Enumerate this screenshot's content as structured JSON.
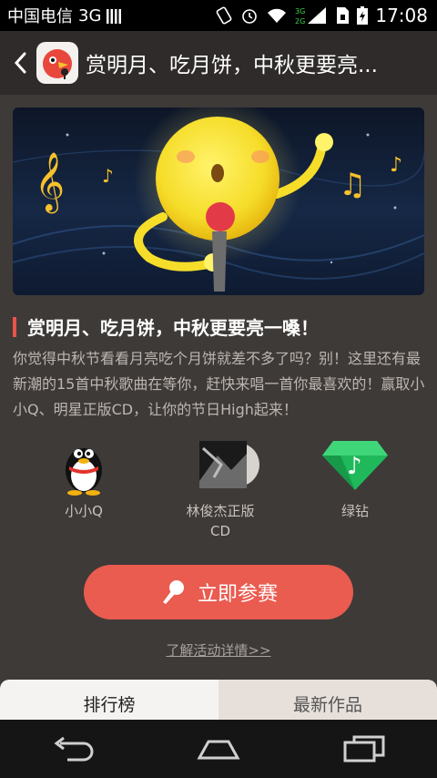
{
  "status_bar": {
    "carrier": "中国电信",
    "network": "3G",
    "time": "17:08"
  },
  "header": {
    "title": "赏明月、吃月饼，中秋更要亮..."
  },
  "event": {
    "heading": "赏明月、吃月饼，中秋更要亮一嗓！",
    "description": "你觉得中秋节看看月亮吃个月饼就差不多了吗？别！这里还有最新潮的15首中秋歌曲在等你，赶快来唱一首你最喜欢的！赢取小小Q、明星正版CD，让你的节日High起来！"
  },
  "prizes": [
    {
      "label": "小小Q",
      "icon": "qq-penguin-icon"
    },
    {
      "label": "林俊杰正版CD",
      "icon": "cd-album-icon"
    },
    {
      "label": "绿钻",
      "icon": "green-diamond-icon"
    }
  ],
  "actions": {
    "join_label": "立即参赛",
    "details_link": "了解活动详情>>"
  },
  "tabs": [
    {
      "label": "排行榜",
      "active": true
    },
    {
      "label": "最新作品",
      "active": false
    }
  ],
  "colors": {
    "accent": "#ea5b50",
    "background": "#3e3a38",
    "titlebar": "#2f2b2a"
  }
}
